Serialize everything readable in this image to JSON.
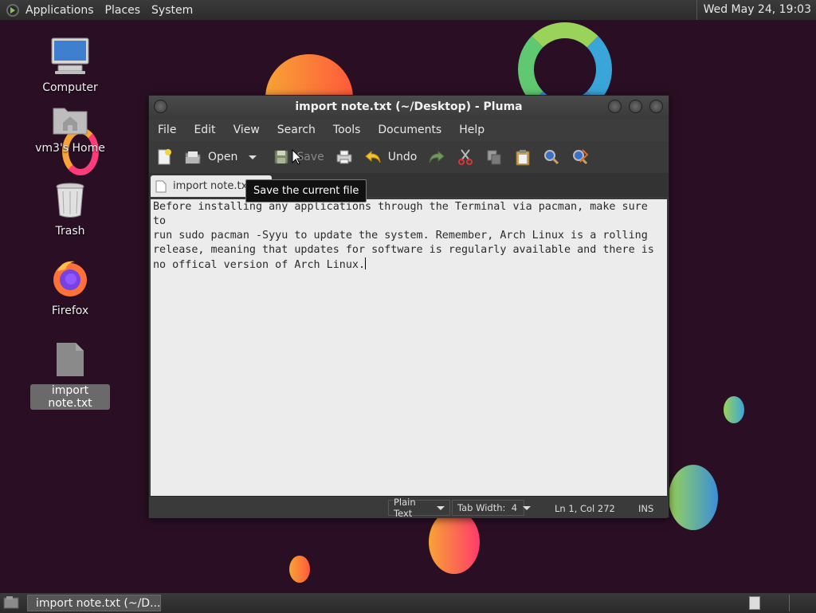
{
  "top_panel": {
    "menus": [
      "Applications",
      "Places",
      "System"
    ],
    "clock": "Wed May 24, 19:03"
  },
  "desktop": {
    "icons": [
      {
        "label": "Computer",
        "icon": "computer-icon"
      },
      {
        "label": "vm3's Home",
        "icon": "home-folder-icon"
      },
      {
        "label": "Trash",
        "icon": "trash-icon"
      },
      {
        "label": "Firefox",
        "icon": "firefox-icon"
      },
      {
        "label": "import note.txt",
        "icon": "text-file-icon",
        "selected": true
      }
    ]
  },
  "window": {
    "title": "import note.txt (~/Desktop) - Pluma",
    "menu": [
      "File",
      "Edit",
      "View",
      "Search",
      "Tools",
      "Documents",
      "Help"
    ],
    "toolbar": {
      "open_label": "Open",
      "save_label": "Save",
      "undo_label": "Undo"
    },
    "tooltip": "Save the current file",
    "tab_label": "import note.txt",
    "editor_text": "Before installing any applications through the Terminal via pacman, make sure to\nrun sudo pacman -Syyu to update the system. Remember, Arch Linux is a rolling\nrelease, meaning that updates for software is regularly available and there is\nno offical version of Arch Linux.",
    "statusbar": {
      "language": "Plain Text",
      "tab_width": "Tab Width:  4",
      "position": "Ln 1, Col 272",
      "mode": "INS"
    }
  },
  "taskbar": {
    "task_label": "import note.txt (~/D..."
  },
  "colors": {
    "desktop_bg": "#2a0f24",
    "panel_bg": "#333333",
    "editor_bg": "#ececec"
  }
}
